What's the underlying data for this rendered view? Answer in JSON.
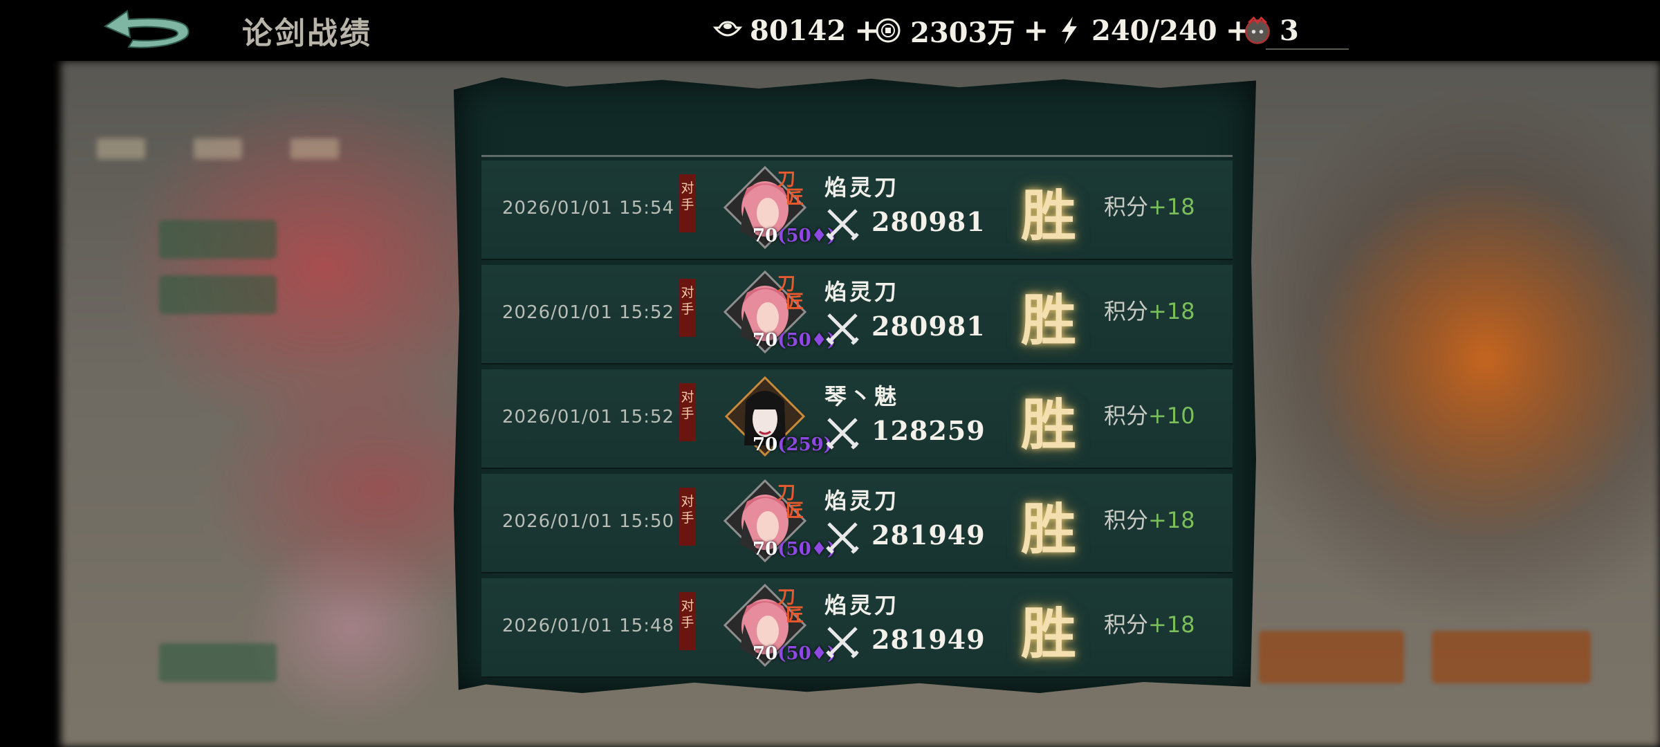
{
  "header": {
    "title": "论剑战绩",
    "back_icon": "back-arrow-icon"
  },
  "resources": [
    {
      "icon": "silver-ingot-icon",
      "value": "80142",
      "add": "+"
    },
    {
      "icon": "coin-icon",
      "value": "2303万",
      "add": "+"
    },
    {
      "icon": "stamina-lightning-icon",
      "value": "240/240",
      "add": "+"
    },
    {
      "icon": "mask-token-icon",
      "value": "3"
    }
  ],
  "records": [
    {
      "time": "2026/01/01 15:54",
      "tag": "对手",
      "name": "焰灵刀",
      "level": "70",
      "level_sub": "(50♦)",
      "power": "280981",
      "result": "胜",
      "score_label": "积分",
      "score_delta": "+18",
      "avatar": "pink-hair-swordsman-avatar"
    },
    {
      "time": "2026/01/01 15:52",
      "tag": "对手",
      "name": "焰灵刀",
      "level": "70",
      "level_sub": "(50♦)",
      "power": "280981",
      "result": "胜",
      "score_label": "积分",
      "score_delta": "+18",
      "avatar": "pink-hair-swordsman-avatar"
    },
    {
      "time": "2026/01/01 15:52",
      "tag": "对手",
      "name": "琴丶魅",
      "level": "70",
      "level_sub": "(259)",
      "power": "128259",
      "result": "胜",
      "score_label": "积分",
      "score_delta": "+10",
      "avatar": "dark-hair-woman-avatar"
    },
    {
      "time": "2026/01/01 15:50",
      "tag": "对手",
      "name": "焰灵刀",
      "level": "70",
      "level_sub": "(50♦)",
      "power": "281949",
      "result": "胜",
      "score_label": "积分",
      "score_delta": "+18",
      "avatar": "pink-hair-swordsman-avatar"
    },
    {
      "time": "2026/01/01 15:48",
      "tag": "对手",
      "name": "焰灵刀",
      "level": "70",
      "level_sub": "(50♦)",
      "power": "281949",
      "result": "胜",
      "score_label": "积分",
      "score_delta": "+18",
      "avatar": "pink-hair-swordsman-avatar"
    }
  ],
  "colors": {
    "panel": "#112a27",
    "row": "#1b3935",
    "win_glow": "#f3dfb0",
    "score_positive": "#7bbf5c",
    "tag_red": "#6b1511",
    "level_purple": "#8d49e0"
  }
}
